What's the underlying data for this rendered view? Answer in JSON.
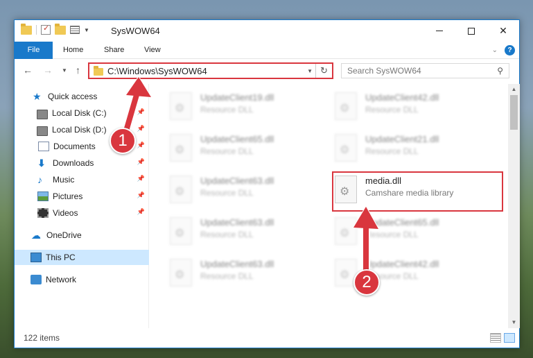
{
  "window": {
    "title": "SysWOW64"
  },
  "ribbon": {
    "tabs": [
      "File",
      "Home",
      "Share",
      "View"
    ]
  },
  "address": {
    "path": "C:\\Windows\\SysWOW64",
    "search_placeholder": "Search SysWOW64"
  },
  "sidebar": {
    "items": [
      {
        "label": "Quick access",
        "icon": "star-icon"
      },
      {
        "label": "Local Disk (C:)",
        "icon": "drive-icon",
        "pinned": true
      },
      {
        "label": "Local Disk (D:)",
        "icon": "drive-icon",
        "pinned": true
      },
      {
        "label": "Documents",
        "icon": "documents-icon",
        "pinned": true
      },
      {
        "label": "Downloads",
        "icon": "downloads-icon",
        "pinned": true
      },
      {
        "label": "Music",
        "icon": "music-icon",
        "pinned": true
      },
      {
        "label": "Pictures",
        "icon": "pictures-icon",
        "pinned": true
      },
      {
        "label": "Videos",
        "icon": "videos-icon",
        "pinned": true
      },
      {
        "label": "OneDrive",
        "icon": "onedrive-icon"
      },
      {
        "label": "This PC",
        "icon": "this-pc-icon",
        "selected": true
      },
      {
        "label": "Network",
        "icon": "network-icon"
      }
    ]
  },
  "files": [
    {
      "name": "UpdateClient19.dll",
      "desc": "Resource DLL",
      "blurred": true
    },
    {
      "name": "UpdateClient42.dll",
      "desc": "Resource DLL",
      "blurred": true
    },
    {
      "name": "UpdateClient65.dll",
      "desc": "Resource DLL",
      "blurred": true
    },
    {
      "name": "UpdateClient21.dll",
      "desc": "Resource DLL",
      "blurred": true
    },
    {
      "name": "UpdateClient63.dll",
      "desc": "Resource DLL",
      "blurred": true
    },
    {
      "name": "media.dll",
      "desc": "Camshare media library",
      "blurred": false,
      "highlighted": true
    },
    {
      "name": "UpdateClient63.dll",
      "desc": "Resource DLL",
      "blurred": true
    },
    {
      "name": "UpdateClient65.dll",
      "desc": "Resource DLL",
      "blurred": true
    },
    {
      "name": "UpdateClient63.dll",
      "desc": "Resource DLL",
      "blurred": true
    },
    {
      "name": "UpdateClient42.dll",
      "desc": "Resource DLL",
      "blurred": true
    }
  ],
  "status": {
    "item_count": "122 items"
  },
  "annotations": [
    {
      "number": "1"
    },
    {
      "number": "2"
    }
  ],
  "colors": {
    "accent": "#1979ca",
    "highlight": "#d9363e",
    "selected": "#cde8ff"
  }
}
